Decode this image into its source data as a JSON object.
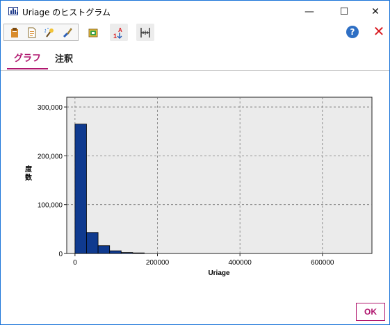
{
  "window": {
    "title": "Uriage のヒストグラム",
    "controls": {
      "minimize": "—",
      "maximize": "☐",
      "close": "✕"
    }
  },
  "toolbar": {
    "icons": [
      "clipboard-icon",
      "document-icon",
      "clean-icon",
      "brush-icon",
      "gallery-icon",
      "sort-icon",
      "axis-icon",
      "help-icon",
      "delete-icon"
    ],
    "help_label": "?",
    "delete_label": "✕"
  },
  "tabs": [
    {
      "label": "グラフ",
      "active": true
    },
    {
      "label": "注釈",
      "active": false
    }
  ],
  "colors": {
    "accent": "#b0166e",
    "bar": "#0f3a8f",
    "plot_bg": "#ebebeb"
  },
  "chart_data": {
    "type": "bar",
    "title": "",
    "xlabel": "Uriage",
    "ylabel": "度数",
    "xlim": [
      -20000,
      720000
    ],
    "ylim": [
      0,
      320000
    ],
    "x_ticks": [
      0,
      200000,
      400000,
      600000
    ],
    "x_tick_labels": [
      "0",
      "200000",
      "400000",
      "600000"
    ],
    "y_ticks": [
      0,
      100000,
      200000,
      300000
    ],
    "y_tick_labels": [
      "0",
      "100,000",
      "200,000",
      "300,000"
    ],
    "grid": true,
    "bin_width": 28000,
    "bins": [
      {
        "start": 0,
        "count": 265000
      },
      {
        "start": 28000,
        "count": 43000
      },
      {
        "start": 56000,
        "count": 16000
      },
      {
        "start": 84000,
        "count": 5500
      },
      {
        "start": 112000,
        "count": 2000
      },
      {
        "start": 140000,
        "count": 1200
      }
    ]
  },
  "footer": {
    "ok_label": "OK"
  }
}
